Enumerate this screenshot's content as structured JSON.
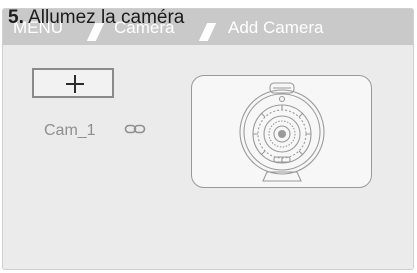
{
  "step": {
    "number": "5.",
    "text": "Allumez la caméra"
  },
  "breadcrumb": {
    "items": [
      "MENU",
      "Camera",
      "Add Camera"
    ]
  },
  "add_button": {
    "icon": "plus-icon"
  },
  "camera": {
    "name": "Cam_1",
    "link_icon": "link-icon",
    "illustration": "camera-device-icon"
  }
}
